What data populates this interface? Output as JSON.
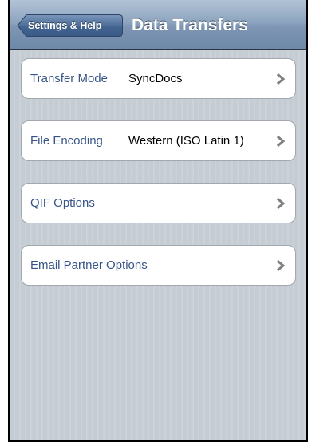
{
  "navbar": {
    "back_label": "Settings & Help",
    "title": "Data Transfers"
  },
  "rows": [
    {
      "label": "Transfer Mode",
      "value": "SyncDocs"
    },
    {
      "label": "File Encoding",
      "value": "Western (ISO Latin 1)"
    },
    {
      "label": "QIF Options",
      "value": ""
    },
    {
      "label": "Email Partner Options",
      "value": ""
    }
  ],
  "colors": {
    "navbar": "#7f97b4",
    "background": "#c5ccd4",
    "label_text": "#385487",
    "value_text": "#000000"
  },
  "icons": {
    "row_accessory": "chevron-right-icon",
    "back": "back-arrow-button"
  }
}
